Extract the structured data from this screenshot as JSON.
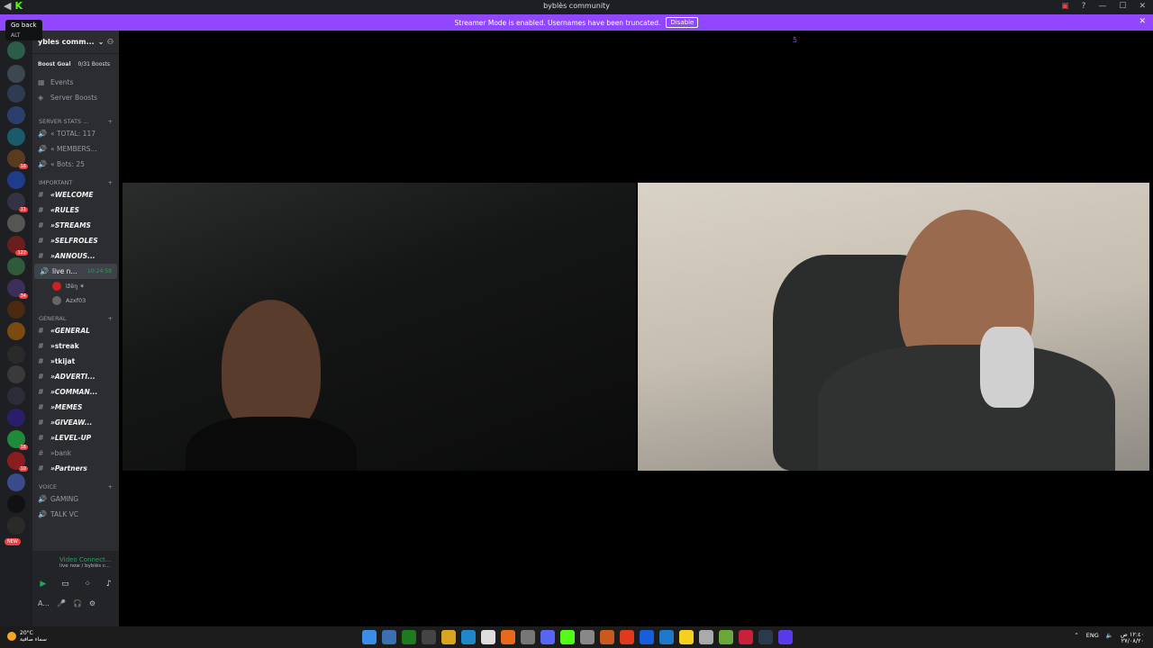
{
  "window": {
    "title": "byblès community"
  },
  "tooltip": {
    "label": "Go back",
    "shortcut": "ALT"
  },
  "banner": {
    "text": "Streamer Mode is enabled. Usernames have been truncated.",
    "disable": "Disable"
  },
  "stray_mark": "5",
  "server": {
    "name": "ybles comm...",
    "boost_goal": "Boost Goal",
    "boost_count": "0/31 Boosts",
    "top_items": [
      "Events",
      "Server Boosts"
    ],
    "stats_category": "SERVER STATS ...",
    "stats": [
      "« TOTAL: 117",
      "« MEMBERS...",
      "« Bots: 25"
    ],
    "important_category": "IMPORTANT",
    "important": [
      "«WELCOME",
      "«RULES",
      "»STREAMS",
      "»SELFROLES",
      "»ANNOUS..."
    ],
    "live_channel": "live n...",
    "live_time": "10:24:59",
    "voice_users": [
      "ìžëŋ ✶",
      "Azxf03"
    ],
    "general_category": "GENERAL",
    "general": [
      "«GENERAL",
      "»streak",
      "»tkijat",
      "»ADVERTI...",
      "»COMMAN...",
      "»MEMES",
      "»GIVEAW...",
      "»LEVEL-UP",
      "»bank",
      "»Partners"
    ],
    "voice_category": "VOICE",
    "voice": [
      "GAMING",
      "TALK VC"
    ]
  },
  "voice_panel": {
    "status": "Video Connect...",
    "channel": "live now / byblès c..."
  },
  "user_panel": {
    "name": "A..."
  },
  "taskbar": {
    "temp": "20°C",
    "weather": "سماء صافية",
    "lang": "ENG",
    "time": "١٢:٤٠ ص",
    "date": "٢٧/٠٨/٢٠"
  },
  "colors": {
    "accent": "#9147ff",
    "live": "#23a55a",
    "badge": "#f23f43"
  }
}
